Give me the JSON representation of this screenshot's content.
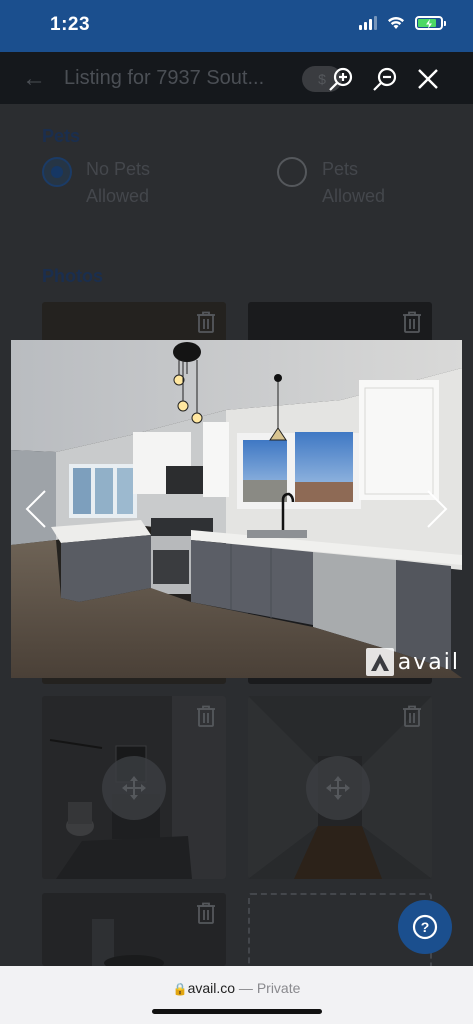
{
  "status_bar": {
    "time": "1:23"
  },
  "header": {
    "back_icon": "back-arrow-icon",
    "title": "Listing for 7937 Sout...",
    "pill": "$",
    "zoom_in_icon": "zoom-in-icon",
    "zoom_out_icon": "zoom-out-icon",
    "close_icon": "close-icon"
  },
  "form": {
    "pets_heading": "Pets",
    "pets_options": [
      {
        "line1": "No Pets",
        "line2": "Allowed",
        "selected": true
      },
      {
        "line1": "Pets",
        "line2": "Allowed",
        "selected": false
      }
    ],
    "photos_heading": "Photos"
  },
  "lightbox": {
    "watermark": "avail",
    "prev_icon": "chevron-left-icon",
    "next_icon": "chevron-right-icon"
  },
  "help": {
    "icon": "help-question-icon",
    "label": "?"
  },
  "browser": {
    "domain": "avail.co",
    "separator": "—",
    "mode": "Private"
  },
  "colors": {
    "brand_blue": "#1b4f8e",
    "overlay": "#2b2d30",
    "browser_bar": "#f2f2f4"
  }
}
